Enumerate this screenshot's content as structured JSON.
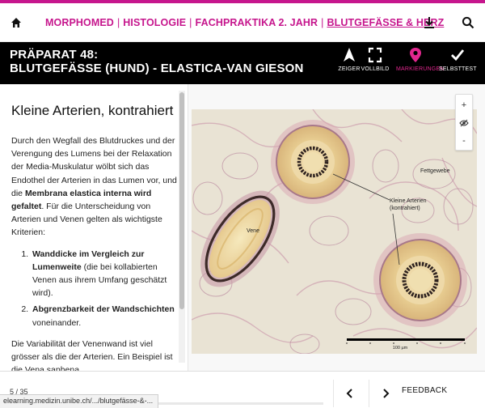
{
  "nav": {
    "breadcrumb": [
      "MORPHOMED",
      "HISTOLOGIE",
      "FACHPRAKTIKA 2. JAHR",
      "BLUTGEFÄSSE & HERZ"
    ],
    "separator": "|"
  },
  "title": {
    "line1": "PRÄPARAT 48:",
    "line2": "BLUTGEFÄSSE (HUND) - ELASTICA-VAN GIESON"
  },
  "tools": [
    {
      "label": "ZEIGER",
      "icon": "pointer-arrow-icon",
      "active": false
    },
    {
      "label": "VOLLBILD",
      "icon": "fullscreen-icon",
      "active": false
    },
    {
      "label": "MARKIERUNGEN",
      "icon": "map-pin-icon",
      "active": true
    },
    {
      "label": "SELBSTTEST",
      "icon": "checkmark-icon",
      "active": false
    }
  ],
  "content": {
    "heading": "Kleine Arterien, kontrahiert",
    "para1_a": "Durch den Wegfall des Blutdruckes und der Verengung des Lumens bei der Relaxation der Media-Muskulatur wölbt sich das Endothel der Arterien in das Lumen vor, und die ",
    "para1_b": "Membrana elastica interna wird gefaltet",
    "para1_c": ". Für die Unterscheidung von Arterien und Venen gelten als wichtigste Kriterien:",
    "item1_b": "Wanddicke im Vergleich zur Lumenweite",
    "item1_c": " (die bei kollabierten Venen aus ihrem Umfang geschätzt wird).",
    "item2_b": "Abgrenzbarkeit der Wandschichten",
    "item2_c": " voneinander.",
    "para2": "Die Variabilität der Venenwand ist viel grösser als die der Arterien. Ein Beispiel ist die Vena saphena."
  },
  "image": {
    "labels": {
      "vene": "Vene",
      "fettgewebe": "Fettgewebe",
      "arterien_1": "Kleine Arterien",
      "arterien_2": "(kontrahiert)",
      "scale": "100 µm"
    },
    "zoom": {
      "plus": "+",
      "minus": "-"
    }
  },
  "footer": {
    "pager": "5 / 35",
    "progress": 0.143,
    "feedback": "FEEDBACK",
    "status_url": "elearning.medizin.unibe.ch/.../blutgefässe-&-..."
  },
  "colors": {
    "accent": "#c6168d",
    "titlebar": "#000000"
  }
}
